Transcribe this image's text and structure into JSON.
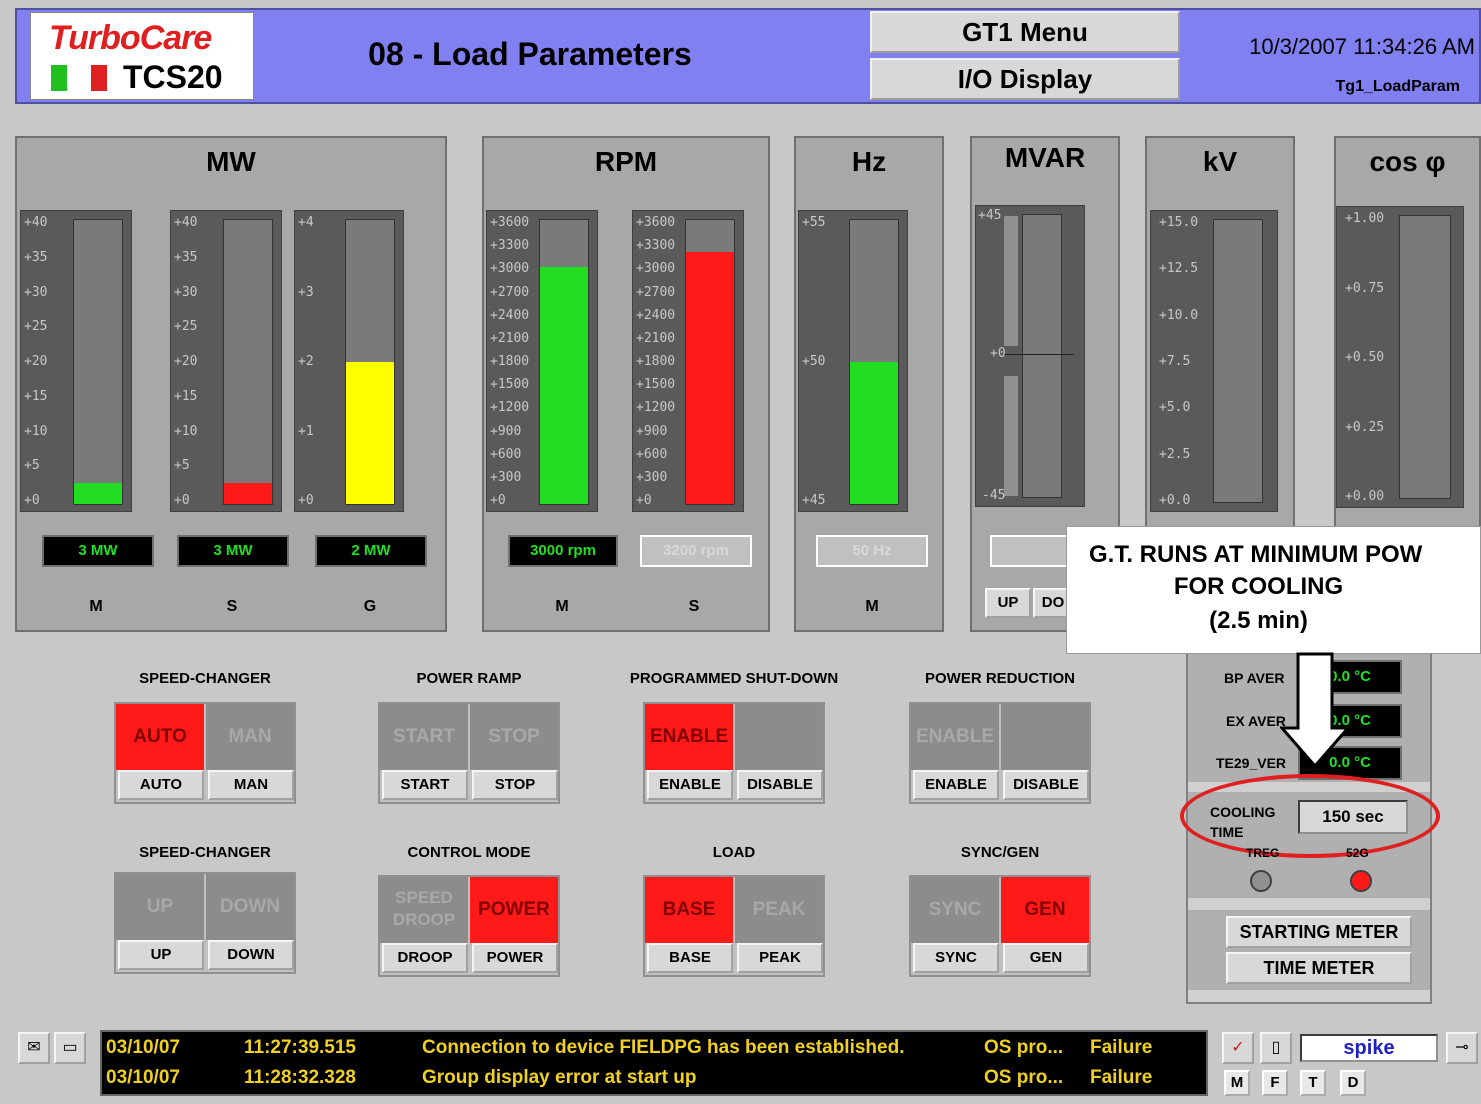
{
  "header": {
    "brand": "TurboCare",
    "model": "TCS20",
    "title": "08 - Load Parameters",
    "menu1": "GT1 Menu",
    "menu2": "I/O Display",
    "datetime": "10/3/2007 11:34:26 AM",
    "screen_id": "Tg1_LoadParam"
  },
  "panels": {
    "mw": {
      "title": "MW",
      "gauges": [
        {
          "label": "M",
          "readout": "3 MW",
          "ticks": [
            "+40",
            "+35",
            "+30",
            "+25",
            "+20",
            "+15",
            "+10",
            "+5",
            "+0"
          ],
          "fill_fraction": 0.075,
          "color": "#22dd22"
        },
        {
          "label": "S",
          "readout": "3 MW",
          "ticks": [
            "+40",
            "+35",
            "+30",
            "+25",
            "+20",
            "+15",
            "+10",
            "+5",
            "+0"
          ],
          "fill_fraction": 0.075,
          "color": "#ff1a1a"
        },
        {
          "label": "G",
          "readout": "2 MW",
          "ticks": [
            "+4",
            "+3",
            "+2",
            "+1",
            "+0"
          ],
          "fill_fraction": 0.5,
          "color": "#ffff00"
        }
      ]
    },
    "rpm": {
      "title": "RPM",
      "gauges": [
        {
          "label": "M",
          "readout": "3000 rpm",
          "ticks": [
            "+3600",
            "+3300",
            "+3000",
            "+2700",
            "+2400",
            "+2100",
            "+1800",
            "+1500",
            "+1200",
            "+900",
            "+600",
            "+300",
            "+0"
          ],
          "fill_fraction": 0.833,
          "color": "#22dd22"
        },
        {
          "label": "S",
          "readout": "3200 rpm",
          "ticks": [
            "+3600",
            "+3300",
            "+3000",
            "+2700",
            "+2400",
            "+2100",
            "+1800",
            "+1500",
            "+1200",
            "+900",
            "+600",
            "+300",
            "+0"
          ],
          "fill_fraction": 0.888,
          "color": "#ff1a1a"
        }
      ]
    },
    "hz": {
      "title": "Hz",
      "gauges": [
        {
          "label": "M",
          "readout": "50 Hz",
          "ticks": [
            "+55",
            "+50",
            "+45"
          ],
          "fill_fraction": 0.5,
          "color": "#22dd22"
        }
      ]
    },
    "mvar": {
      "title": "MVAR",
      "ticks": [
        "+45",
        "+0",
        "-45"
      ],
      "up_label": "UP",
      "down_label": "DO"
    },
    "kv": {
      "title": "kV",
      "ticks": [
        "+15.0",
        "+12.5",
        "+10.0",
        "+7.5",
        "+5.0",
        "+2.5",
        "+0.0"
      ]
    },
    "cos": {
      "title": "cos φ",
      "ticks": [
        "+1.00",
        "+0.75",
        "+0.50",
        "+0.25",
        "+0.00"
      ]
    }
  },
  "controls": [
    {
      "title": "SPEED-CHANGER",
      "states": [
        {
          "text": "AUTO",
          "on": true
        },
        {
          "text": "MAN",
          "on": false
        }
      ],
      "buttons": [
        "AUTO",
        "MAN"
      ]
    },
    {
      "title": "POWER RAMP",
      "states": [
        {
          "text": "START",
          "on": false
        },
        {
          "text": "STOP",
          "on": false
        }
      ],
      "buttons": [
        "START",
        "STOP"
      ]
    },
    {
      "title": "PROGRAMMED SHUT-DOWN",
      "states": [
        {
          "text": "ENABLE",
          "on": true
        },
        {
          "text": "",
          "on": false
        }
      ],
      "buttons": [
        "ENABLE",
        "DISABLE"
      ]
    },
    {
      "title": "POWER REDUCTION",
      "states": [
        {
          "text": "ENABLE",
          "on": false
        },
        {
          "text": "",
          "on": false
        }
      ],
      "buttons": [
        "ENABLE",
        "DISABLE"
      ]
    },
    {
      "title": "SPEED-CHANGER",
      "states": [
        {
          "text": "UP",
          "on": false
        },
        {
          "text": "DOWN",
          "on": false
        }
      ],
      "buttons": [
        "UP",
        "DOWN"
      ]
    },
    {
      "title": "CONTROL MODE",
      "states": [
        {
          "text": "SPEED DROOP",
          "on": false
        },
        {
          "text": "POWER",
          "on": true
        }
      ],
      "buttons": [
        "DROOP",
        "POWER"
      ]
    },
    {
      "title": "LOAD",
      "states": [
        {
          "text": "BASE",
          "on": true
        },
        {
          "text": "PEAK",
          "on": false
        }
      ],
      "buttons": [
        "BASE",
        "PEAK"
      ]
    },
    {
      "title": "SYNC/GEN",
      "states": [
        {
          "text": "SYNC",
          "on": false
        },
        {
          "text": "GEN",
          "on": true
        }
      ],
      "buttons": [
        "SYNC",
        "GEN"
      ]
    }
  ],
  "temps": {
    "bp_label": "BP AVER",
    "bp_value": "0.0 °C",
    "ex_label": "EX AVER",
    "ex_value": "0.0 °C",
    "te_label": "TE29_VER",
    "te_value": "0.0 °C",
    "cooling_label1": "COOLING",
    "cooling_label2": "TIME",
    "cooling_value": "150 sec",
    "lamp1_label": "TREG",
    "lamp2_label": "52G",
    "starting_meter": "STARTING METER",
    "time_meter": "TIME METER"
  },
  "callout": {
    "line1": "G.T. RUNS AT MINIMUM POW",
    "line2": "FOR COOLING",
    "line3": "(2.5 min)"
  },
  "alarms": [
    {
      "date": "03/10/07",
      "time": "11:27:39.515",
      "message": "Connection to device FIELDPG has been established.",
      "source": "OS pro...",
      "status": "Failure"
    },
    {
      "date": "03/10/07",
      "time": "11:28:32.328",
      "message": "Group display error at start up",
      "source": "OS pro...",
      "status": "Failure"
    }
  ],
  "footer": {
    "user": "spike",
    "btn_m": "M",
    "btn_f": "F",
    "btn_t": "T",
    "btn_d": "D"
  }
}
